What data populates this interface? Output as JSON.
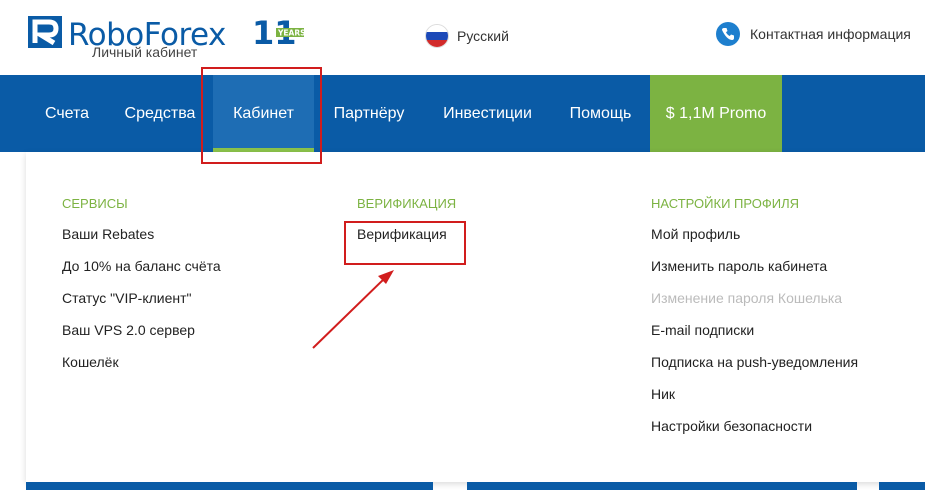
{
  "header": {
    "brand": "RoboForex",
    "brand_sub": "Личный кабинет",
    "anniversary_number": "11",
    "anniversary_word": "YEARS",
    "language": "Русский",
    "contact": "Контактная информация"
  },
  "nav": {
    "items": [
      {
        "label": "Счета"
      },
      {
        "label": "Средства"
      },
      {
        "label": "Кабинет"
      },
      {
        "label": "Партнёру"
      },
      {
        "label": "Инвестиции"
      },
      {
        "label": "Помощь"
      },
      {
        "label": "$ 1,1M Promo"
      }
    ],
    "active": "Кабинет"
  },
  "menu": {
    "services": {
      "title": "Сервисы",
      "links": [
        "Ваши Rebates",
        "До 10% на баланс счёта",
        "Статус \"VIP-клиент\"",
        "Ваш VPS 2.0 сервер",
        "Кошелёк"
      ]
    },
    "verification": {
      "title": "Верификация",
      "links": [
        "Верификация"
      ]
    },
    "profile": {
      "title": "Настройки профиля",
      "links": [
        "Мой профиль",
        "Изменить пароль кабинета",
        "Изменение пароля Кошелька",
        "E-mail подписки",
        "Подписка на push-уведомления",
        "Ник",
        "Настройки безопасности"
      ],
      "disabled_index": 2
    }
  },
  "colors": {
    "brand_blue": "#0a5ba6",
    "accent_green": "#7cb342",
    "annotation_red": "#d11d1d"
  }
}
